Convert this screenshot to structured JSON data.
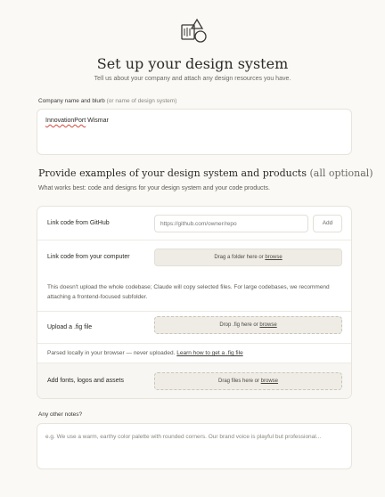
{
  "header": {
    "logo_icon": "design-system-shapes-icon",
    "title": "Set up your design system",
    "subtitle": "Tell us about your company and attach any design resources you have."
  },
  "company": {
    "label": "Company name and blurb",
    "label_hint": "(or name of design system)",
    "value_word1": "InnovationPort",
    "value_word2": " Wismar"
  },
  "examples": {
    "heading": "Provide examples of your design system and products",
    "heading_opt": "(all optional)",
    "subheading": "What works best: code and designs for your design system and your code products."
  },
  "rows": {
    "github": {
      "label": "Link code from GitHub",
      "placeholder": "https://github.com/owner/repo",
      "add_label": "Add"
    },
    "computer": {
      "label": "Link code from your computer",
      "drop_text": "Drag a folder here or ",
      "drop_link": "browse",
      "note": "This doesn't upload the whole codebase; Claude will copy selected files. For large codebases, we recommend attaching a frontend-focused subfolder."
    },
    "fig": {
      "label": "Upload a .fig file",
      "drop_text": "Drop .fig here or ",
      "drop_link": "browse",
      "note_text": "Parsed locally in your browser — never uploaded. ",
      "note_link": "Learn how to get a .fig file"
    },
    "assets": {
      "label": "Add fonts, logos and assets",
      "drop_text": "Drag files here or ",
      "drop_link": "browse"
    }
  },
  "notes": {
    "label": "Any other notes?",
    "placeholder": "e.g. We use a warm, earthy color palette with rounded corners. Our brand voice is playful but professional..."
  },
  "colors": {
    "background": "#faf9f5",
    "card": "#ffffff",
    "dropzone": "#eeece4",
    "spellcheck": "#d24a3c"
  }
}
